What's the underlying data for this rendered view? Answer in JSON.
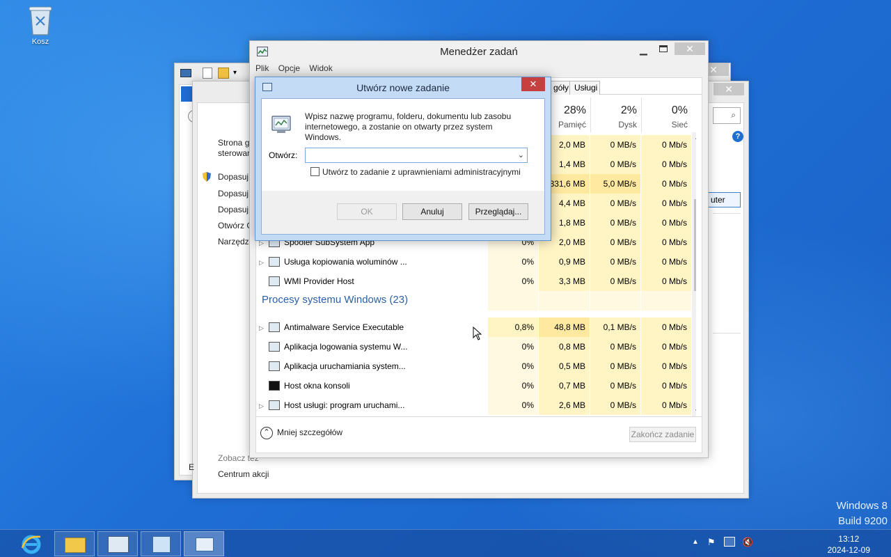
{
  "desktop": {
    "recycle_bin_label": "Kosz",
    "watermark_line1": "Windows 8",
    "watermark_line2": "Build 9200"
  },
  "control_panel": {
    "left_links": [
      "Strona g",
      "sterowar",
      "Dopasuj",
      "Dopasuj",
      "Dopasuj",
      "Otwórz C",
      "Narzędzi"
    ],
    "see_also": "Zobacz też",
    "action_center": "Centrum akcji",
    "button_partial": "uter",
    "edge_letter": "E"
  },
  "task_manager": {
    "title": "Menedżer zadań",
    "menu": [
      "Plik",
      "Opcje",
      "Widok"
    ],
    "tabs": [
      "góły",
      "Usługi"
    ],
    "columns": [
      {
        "pct": "28%",
        "name": "Pamięć"
      },
      {
        "pct": "2%",
        "name": "Dysk"
      },
      {
        "pct": "0%",
        "name": "Sieć"
      }
    ],
    "rows_top": [
      {
        "mem": "2,0 MB",
        "disk": "0 MB/s",
        "net": "0 Mb/s"
      },
      {
        "mem": "1,4 MB",
        "disk": "0 MB/s",
        "net": "0 Mb/s"
      },
      {
        "mem": "331,6 MB",
        "disk": "5,0 MB/s",
        "net": "0 Mb/s"
      },
      {
        "mem": "4,4 MB",
        "disk": "0 MB/s",
        "net": "0 Mb/s"
      },
      {
        "mem": "1,8 MB",
        "disk": "0 MB/s",
        "net": "0 Mb/s"
      }
    ],
    "rows_mid": [
      {
        "name": "Spooler SubSystem App",
        "cpu": "0%",
        "mem": "2,0 MB",
        "disk": "0 MB/s",
        "net": "0 Mb/s",
        "expand": true
      },
      {
        "name": "Usługa kopiowania woluminów ...",
        "cpu": "0%",
        "mem": "0,9 MB",
        "disk": "0 MB/s",
        "net": "0 Mb/s",
        "expand": true
      },
      {
        "name": "WMI Provider Host",
        "cpu": "0%",
        "mem": "3,3 MB",
        "disk": "0 MB/s",
        "net": "0 Mb/s",
        "expand": false
      }
    ],
    "group_header": "Procesy systemu Windows (23)",
    "rows_group": [
      {
        "name": "Antimalware Service Executable",
        "cpu": "0,8%",
        "mem": "48,8 MB",
        "disk": "0,1 MB/s",
        "net": "0 Mb/s",
        "expand": true
      },
      {
        "name": "Aplikacja logowania systemu W...",
        "cpu": "0%",
        "mem": "0,8 MB",
        "disk": "0 MB/s",
        "net": "0 Mb/s",
        "expand": false
      },
      {
        "name": "Aplikacja uruchamiania system...",
        "cpu": "0%",
        "mem": "0,5 MB",
        "disk": "0 MB/s",
        "net": "0 Mb/s",
        "expand": false
      },
      {
        "name": "Host okna konsoli",
        "cpu": "0%",
        "mem": "0,7 MB",
        "disk": "0 MB/s",
        "net": "0 Mb/s",
        "expand": false
      },
      {
        "name": "Host usługi: program uruchami...",
        "cpu": "0%",
        "mem": "2,6 MB",
        "disk": "0 MB/s",
        "net": "0 Mb/s",
        "expand": true
      }
    ],
    "less_details": "Mniej szczegółów",
    "end_task": "Zakończ zadanie"
  },
  "dialog": {
    "title": "Utwórz nowe zadanie",
    "close_glyph": "✕",
    "description": "Wpisz nazwę programu, folderu, dokumentu lub zasobu internetowego, a zostanie on otwarty przez system Windows.",
    "open_label": "Otwórz:",
    "open_value": "",
    "admin_checkbox": "Utwórz to zadanie z uprawnieniami administracyjnymi",
    "ok": "OK",
    "cancel": "Anuluj",
    "browse": "Przeglądaj..."
  },
  "taskbar": {
    "time": "13:12",
    "date": "2024-12-09"
  },
  "colors": {
    "accent_group": "#2b5fa8",
    "close_red": "#c74040",
    "heat_light": "#fff4c4",
    "heat_mid": "#ffe9a0"
  }
}
